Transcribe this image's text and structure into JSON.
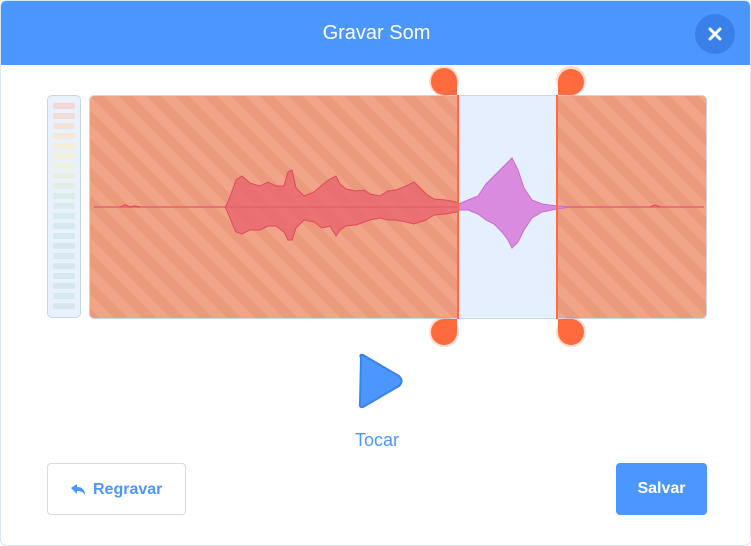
{
  "dialog": {
    "title": "Gravar Som",
    "close_icon": "close-icon"
  },
  "playback": {
    "label": "Tocar",
    "icon": "play-icon"
  },
  "actions": {
    "rerecord_label": "Regravar",
    "rerecord_icon": "undo-arrow-icon",
    "save_label": "Salvar"
  },
  "trim": {
    "start_fraction": 0.6,
    "end_fraction": 0.76
  },
  "colors": {
    "header": "#4c97ff",
    "trimmed_overlay": "#f39c7d",
    "handle": "#ff6b3d",
    "waveform_trimmed": "#e8606e",
    "waveform_selected": "#d98cdf",
    "play": "#4c97ff"
  }
}
